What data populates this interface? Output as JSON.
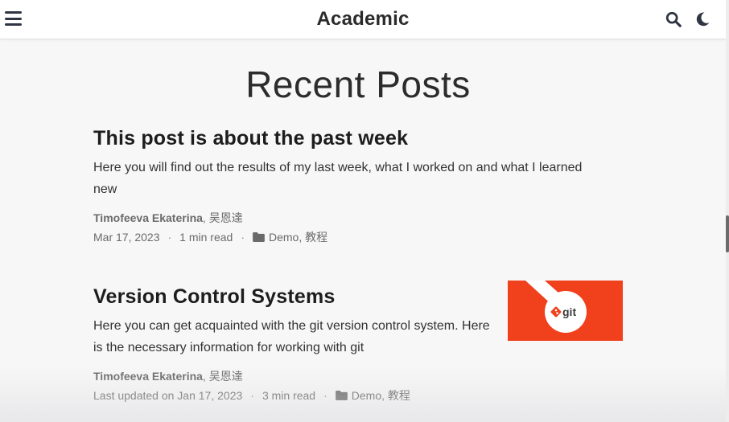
{
  "navbar": {
    "brand": "Academic",
    "menu_icon": "hamburger-menu-icon",
    "search_icon": "search-icon",
    "theme_icon": "moon-icon"
  },
  "page": {
    "title": "Recent Posts"
  },
  "posts": [
    {
      "title": "This post is about the past week",
      "summary_line1": "Here you will find out the results of my last week, what I worked on and what I learned",
      "summary_line2": "new",
      "author_primary": "Timofeeva Ekaterina",
      "author_rest": ", 吴恩達",
      "date": "Mar 17, 2023",
      "reading_time": "1 min read",
      "cat1": "Demo",
      "cat_sep": ", ",
      "cat2": "教程",
      "meta_sep": "·"
    },
    {
      "title": "Version Control Systems",
      "summary_line1": "Here you can get acquainted with the git version control system. Here",
      "summary_line2": "is the necessary information for working with git",
      "author_primary": "Timofeeva Ekaterina",
      "author_rest": ", 吴恩達",
      "date": "Last updated on Jan 17, 2023",
      "reading_time": "3 min read",
      "cat1": "Demo",
      "cat_sep": ", ",
      "cat2": "教程",
      "meta_sep": "·",
      "thumb_logo_text": "git"
    }
  ],
  "colors": {
    "git_red": "#f0401c",
    "text_dark": "#1d1d1d",
    "meta_gray": "#6a6a6a"
  }
}
